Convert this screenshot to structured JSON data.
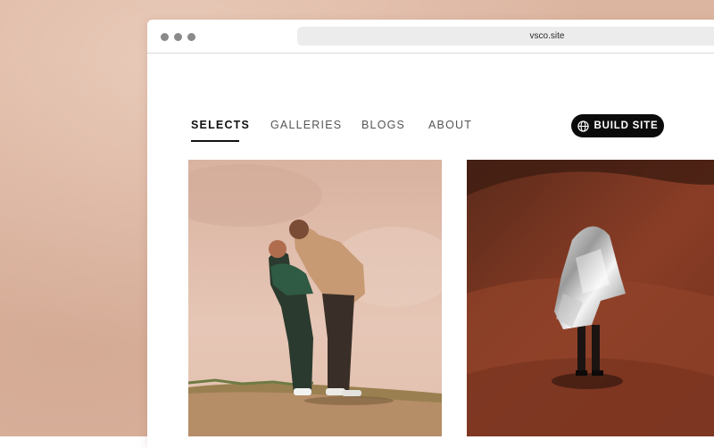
{
  "browser": {
    "url": "vsco.site"
  },
  "nav": {
    "items": [
      {
        "label": "SELECTS",
        "active": true
      },
      {
        "label": "GALLERIES",
        "active": false
      },
      {
        "label": "BLOGS",
        "active": false
      },
      {
        "label": "ABOUT",
        "active": false
      }
    ],
    "build_button": {
      "label": "BUILD SITE",
      "icon": "globe-icon"
    }
  },
  "colors": {
    "backdrop": "#dcb5a0",
    "button_bg": "#0b0b0b",
    "active_nav": "#111111",
    "inactive_nav": "#555555"
  }
}
